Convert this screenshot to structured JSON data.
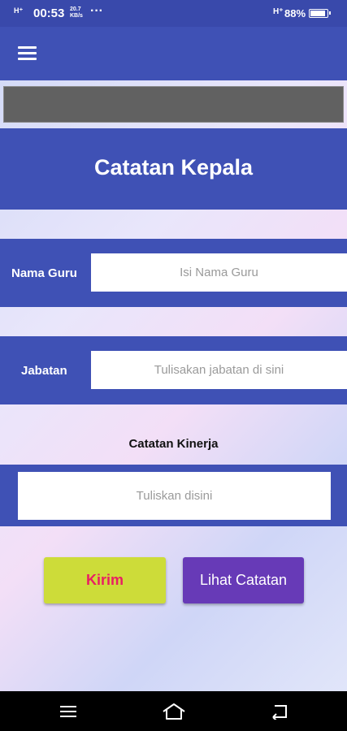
{
  "status_bar": {
    "signal": "H⁺",
    "time": "00:53",
    "speed_value": "20.7",
    "speed_unit": "KB/s",
    "more": "···",
    "network": "H⁺",
    "battery": "88%"
  },
  "app_bar": {
    "menu_icon": "hamburger-menu-icon"
  },
  "header": {
    "title": "Catatan Kepala"
  },
  "form": {
    "name": {
      "label": "Nama Guru",
      "placeholder": "Isi Nama Guru",
      "value": ""
    },
    "position": {
      "label": "Jabatan",
      "placeholder": "Tulisakan jabatan di sini",
      "value": ""
    },
    "notes": {
      "label": "Catatan Kinerja",
      "placeholder": "Tuliskan disini",
      "value": ""
    }
  },
  "actions": {
    "submit": "Kirim",
    "view": "Lihat Catatan"
  },
  "colors": {
    "primary": "#3f51b5",
    "submit_bg": "#cddc39",
    "submit_text": "#e91e63",
    "view_bg": "#673ab7"
  },
  "nav_bar": {
    "icons": [
      "menu-icon",
      "home-icon",
      "back-icon"
    ]
  }
}
